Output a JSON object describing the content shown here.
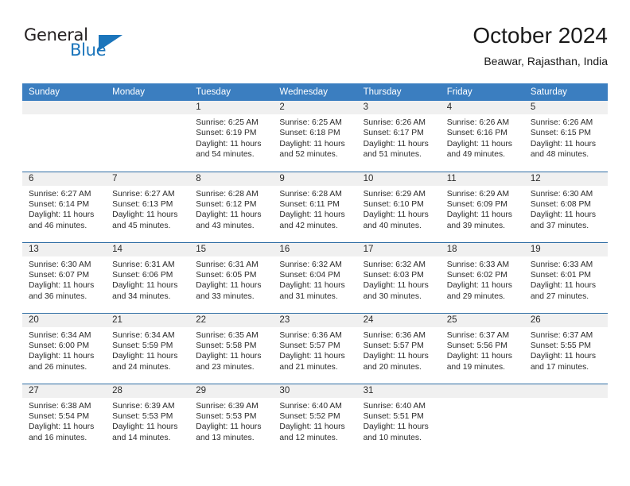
{
  "brand": {
    "name_top": "General",
    "name_bottom": "Blue",
    "triangle_color": "#1b75bb"
  },
  "header": {
    "month_title": "October 2024",
    "location": "Beawar, Rajasthan, India"
  },
  "colors": {
    "header_blue": "#3b7ec0",
    "divider_blue": "#2e6da4",
    "daynum_band": "#f0f0f0"
  },
  "labels": {
    "sunrise_prefix": "Sunrise:",
    "sunset_prefix": "Sunset:",
    "daylight_prefix": "Daylight:"
  },
  "weekdays": [
    "Sunday",
    "Monday",
    "Tuesday",
    "Wednesday",
    "Thursday",
    "Friday",
    "Saturday"
  ],
  "weeks": [
    [
      {
        "day": "",
        "empty": true
      },
      {
        "day": "",
        "empty": true
      },
      {
        "day": "1",
        "sunrise": "Sunrise: 6:25 AM",
        "sunset": "Sunset: 6:19 PM",
        "daylight_1": "Daylight: 11 hours",
        "daylight_2": "and 54 minutes."
      },
      {
        "day": "2",
        "sunrise": "Sunrise: 6:25 AM",
        "sunset": "Sunset: 6:18 PM",
        "daylight_1": "Daylight: 11 hours",
        "daylight_2": "and 52 minutes."
      },
      {
        "day": "3",
        "sunrise": "Sunrise: 6:26 AM",
        "sunset": "Sunset: 6:17 PM",
        "daylight_1": "Daylight: 11 hours",
        "daylight_2": "and 51 minutes."
      },
      {
        "day": "4",
        "sunrise": "Sunrise: 6:26 AM",
        "sunset": "Sunset: 6:16 PM",
        "daylight_1": "Daylight: 11 hours",
        "daylight_2": "and 49 minutes."
      },
      {
        "day": "5",
        "sunrise": "Sunrise: 6:26 AM",
        "sunset": "Sunset: 6:15 PM",
        "daylight_1": "Daylight: 11 hours",
        "daylight_2": "and 48 minutes."
      }
    ],
    [
      {
        "day": "6",
        "sunrise": "Sunrise: 6:27 AM",
        "sunset": "Sunset: 6:14 PM",
        "daylight_1": "Daylight: 11 hours",
        "daylight_2": "and 46 minutes."
      },
      {
        "day": "7",
        "sunrise": "Sunrise: 6:27 AM",
        "sunset": "Sunset: 6:13 PM",
        "daylight_1": "Daylight: 11 hours",
        "daylight_2": "and 45 minutes."
      },
      {
        "day": "8",
        "sunrise": "Sunrise: 6:28 AM",
        "sunset": "Sunset: 6:12 PM",
        "daylight_1": "Daylight: 11 hours",
        "daylight_2": "and 43 minutes."
      },
      {
        "day": "9",
        "sunrise": "Sunrise: 6:28 AM",
        "sunset": "Sunset: 6:11 PM",
        "daylight_1": "Daylight: 11 hours",
        "daylight_2": "and 42 minutes."
      },
      {
        "day": "10",
        "sunrise": "Sunrise: 6:29 AM",
        "sunset": "Sunset: 6:10 PM",
        "daylight_1": "Daylight: 11 hours",
        "daylight_2": "and 40 minutes."
      },
      {
        "day": "11",
        "sunrise": "Sunrise: 6:29 AM",
        "sunset": "Sunset: 6:09 PM",
        "daylight_1": "Daylight: 11 hours",
        "daylight_2": "and 39 minutes."
      },
      {
        "day": "12",
        "sunrise": "Sunrise: 6:30 AM",
        "sunset": "Sunset: 6:08 PM",
        "daylight_1": "Daylight: 11 hours",
        "daylight_2": "and 37 minutes."
      }
    ],
    [
      {
        "day": "13",
        "sunrise": "Sunrise: 6:30 AM",
        "sunset": "Sunset: 6:07 PM",
        "daylight_1": "Daylight: 11 hours",
        "daylight_2": "and 36 minutes."
      },
      {
        "day": "14",
        "sunrise": "Sunrise: 6:31 AM",
        "sunset": "Sunset: 6:06 PM",
        "daylight_1": "Daylight: 11 hours",
        "daylight_2": "and 34 minutes."
      },
      {
        "day": "15",
        "sunrise": "Sunrise: 6:31 AM",
        "sunset": "Sunset: 6:05 PM",
        "daylight_1": "Daylight: 11 hours",
        "daylight_2": "and 33 minutes."
      },
      {
        "day": "16",
        "sunrise": "Sunrise: 6:32 AM",
        "sunset": "Sunset: 6:04 PM",
        "daylight_1": "Daylight: 11 hours",
        "daylight_2": "and 31 minutes."
      },
      {
        "day": "17",
        "sunrise": "Sunrise: 6:32 AM",
        "sunset": "Sunset: 6:03 PM",
        "daylight_1": "Daylight: 11 hours",
        "daylight_2": "and 30 minutes."
      },
      {
        "day": "18",
        "sunrise": "Sunrise: 6:33 AM",
        "sunset": "Sunset: 6:02 PM",
        "daylight_1": "Daylight: 11 hours",
        "daylight_2": "and 29 minutes."
      },
      {
        "day": "19",
        "sunrise": "Sunrise: 6:33 AM",
        "sunset": "Sunset: 6:01 PM",
        "daylight_1": "Daylight: 11 hours",
        "daylight_2": "and 27 minutes."
      }
    ],
    [
      {
        "day": "20",
        "sunrise": "Sunrise: 6:34 AM",
        "sunset": "Sunset: 6:00 PM",
        "daylight_1": "Daylight: 11 hours",
        "daylight_2": "and 26 minutes."
      },
      {
        "day": "21",
        "sunrise": "Sunrise: 6:34 AM",
        "sunset": "Sunset: 5:59 PM",
        "daylight_1": "Daylight: 11 hours",
        "daylight_2": "and 24 minutes."
      },
      {
        "day": "22",
        "sunrise": "Sunrise: 6:35 AM",
        "sunset": "Sunset: 5:58 PM",
        "daylight_1": "Daylight: 11 hours",
        "daylight_2": "and 23 minutes."
      },
      {
        "day": "23",
        "sunrise": "Sunrise: 6:36 AM",
        "sunset": "Sunset: 5:57 PM",
        "daylight_1": "Daylight: 11 hours",
        "daylight_2": "and 21 minutes."
      },
      {
        "day": "24",
        "sunrise": "Sunrise: 6:36 AM",
        "sunset": "Sunset: 5:57 PM",
        "daylight_1": "Daylight: 11 hours",
        "daylight_2": "and 20 minutes."
      },
      {
        "day": "25",
        "sunrise": "Sunrise: 6:37 AM",
        "sunset": "Sunset: 5:56 PM",
        "daylight_1": "Daylight: 11 hours",
        "daylight_2": "and 19 minutes."
      },
      {
        "day": "26",
        "sunrise": "Sunrise: 6:37 AM",
        "sunset": "Sunset: 5:55 PM",
        "daylight_1": "Daylight: 11 hours",
        "daylight_2": "and 17 minutes."
      }
    ],
    [
      {
        "day": "27",
        "sunrise": "Sunrise: 6:38 AM",
        "sunset": "Sunset: 5:54 PM",
        "daylight_1": "Daylight: 11 hours",
        "daylight_2": "and 16 minutes."
      },
      {
        "day": "28",
        "sunrise": "Sunrise: 6:39 AM",
        "sunset": "Sunset: 5:53 PM",
        "daylight_1": "Daylight: 11 hours",
        "daylight_2": "and 14 minutes."
      },
      {
        "day": "29",
        "sunrise": "Sunrise: 6:39 AM",
        "sunset": "Sunset: 5:53 PM",
        "daylight_1": "Daylight: 11 hours",
        "daylight_2": "and 13 minutes."
      },
      {
        "day": "30",
        "sunrise": "Sunrise: 6:40 AM",
        "sunset": "Sunset: 5:52 PM",
        "daylight_1": "Daylight: 11 hours",
        "daylight_2": "and 12 minutes."
      },
      {
        "day": "31",
        "sunrise": "Sunrise: 6:40 AM",
        "sunset": "Sunset: 5:51 PM",
        "daylight_1": "Daylight: 11 hours",
        "daylight_2": "and 10 minutes."
      },
      {
        "day": "",
        "empty": true
      },
      {
        "day": "",
        "empty": true
      }
    ]
  ]
}
